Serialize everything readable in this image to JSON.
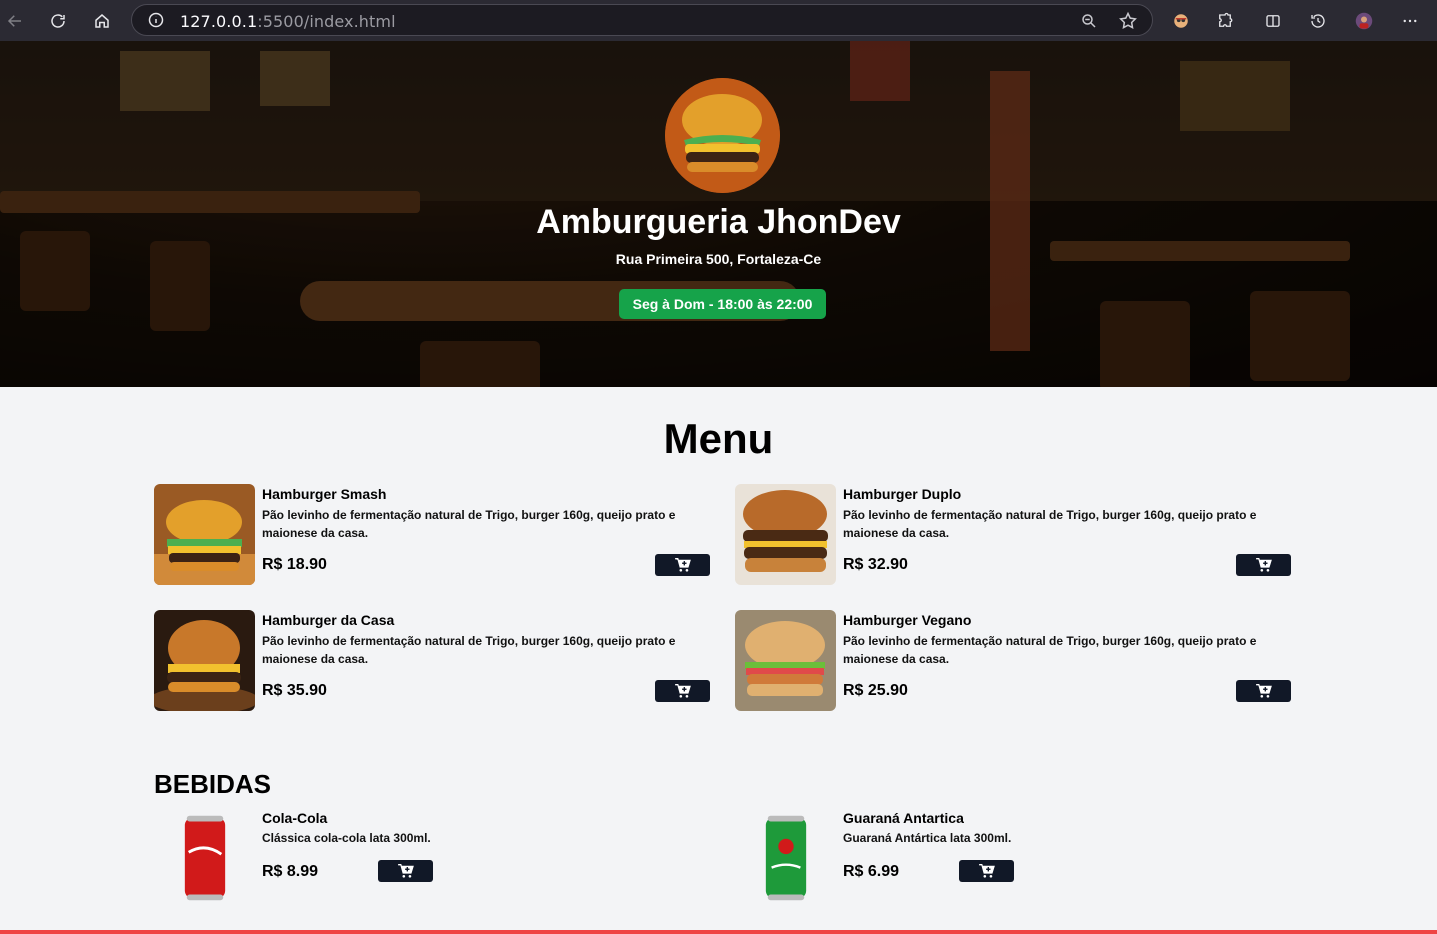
{
  "browser": {
    "url_host": "127.0.0.1",
    "url_rest": ":5500/index.html"
  },
  "hero": {
    "title": "Amburgueria JhonDev",
    "address": "Rua Primeira 500, Fortaleza-Ce",
    "hours": "Seg à Dom - 18:00 às 22:00"
  },
  "menu": {
    "title": "Menu",
    "items": [
      {
        "name": "Hamburger Smash",
        "desc": "Pão levinho de fermentação natural de Trigo, burger 160g, queijo prato e maionese da casa.",
        "price": "R$ 18.90"
      },
      {
        "name": "Hamburger Duplo",
        "desc": "Pão levinho de fermentação natural de Trigo, burger 160g, queijo prato e maionese da casa.",
        "price": "R$ 32.90"
      },
      {
        "name": "Hamburger da Casa",
        "desc": "Pão levinho de fermentação natural de Trigo, burger 160g, queijo prato e maionese da casa.",
        "price": "R$ 35.90"
      },
      {
        "name": "Hamburger Vegano",
        "desc": "Pão levinho de fermentação natural de Trigo, burger 160g, queijo prato e maionese da casa.",
        "price": "R$ 25.90"
      }
    ]
  },
  "bebidas": {
    "title": "BEBIDAS",
    "items": [
      {
        "name": "Cola-Cola",
        "desc": "Clássica cola-cola lata 300ml.",
        "price": "R$ 8.99"
      },
      {
        "name": "Guaraná Antartica",
        "desc": "Guaraná Antártica lata 300ml.",
        "price": "R$ 6.99"
      }
    ]
  },
  "colors": {
    "hours_badge": "#16a34a",
    "cart_button": "#111827",
    "footer_accent": "#ef4444"
  },
  "icons": [
    "back-icon",
    "reload-icon",
    "home-icon",
    "info-icon",
    "zoom-icon",
    "star-icon",
    "extensions-icon",
    "sidebar-icon",
    "history-icon",
    "menu-icon",
    "cart-icon"
  ]
}
